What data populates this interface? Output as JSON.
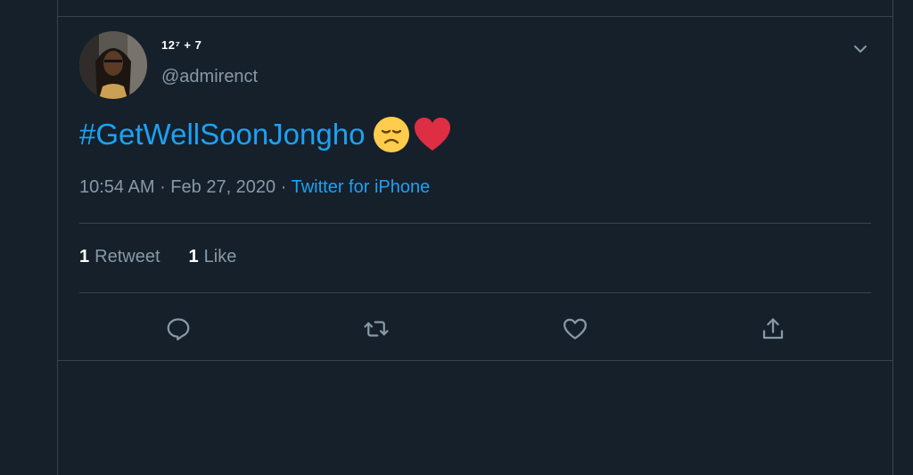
{
  "user": {
    "display_name": "12⁷ + 7",
    "handle": "@admirenct",
    "avatar_icon": "profile-avatar"
  },
  "tweet": {
    "hashtag": "#GetWellSoonJongho",
    "emojis": [
      "disappointed-face",
      "red-heart"
    ],
    "time": "10:54 AM",
    "date": "Feb 27, 2020",
    "separator": " · ",
    "source": "Twitter for iPhone"
  },
  "stats": {
    "retweet_count": "1",
    "retweet_label": "Retweet",
    "like_count": "1",
    "like_label": "Like"
  },
  "actions": [
    "reply-icon",
    "retweet-icon",
    "like-icon",
    "share-icon"
  ],
  "colors": {
    "background": "#15202b",
    "border": "#38444d",
    "accent": "#1da1f2",
    "secondary_text": "#8899a6",
    "primary_text": "#ffffff"
  }
}
